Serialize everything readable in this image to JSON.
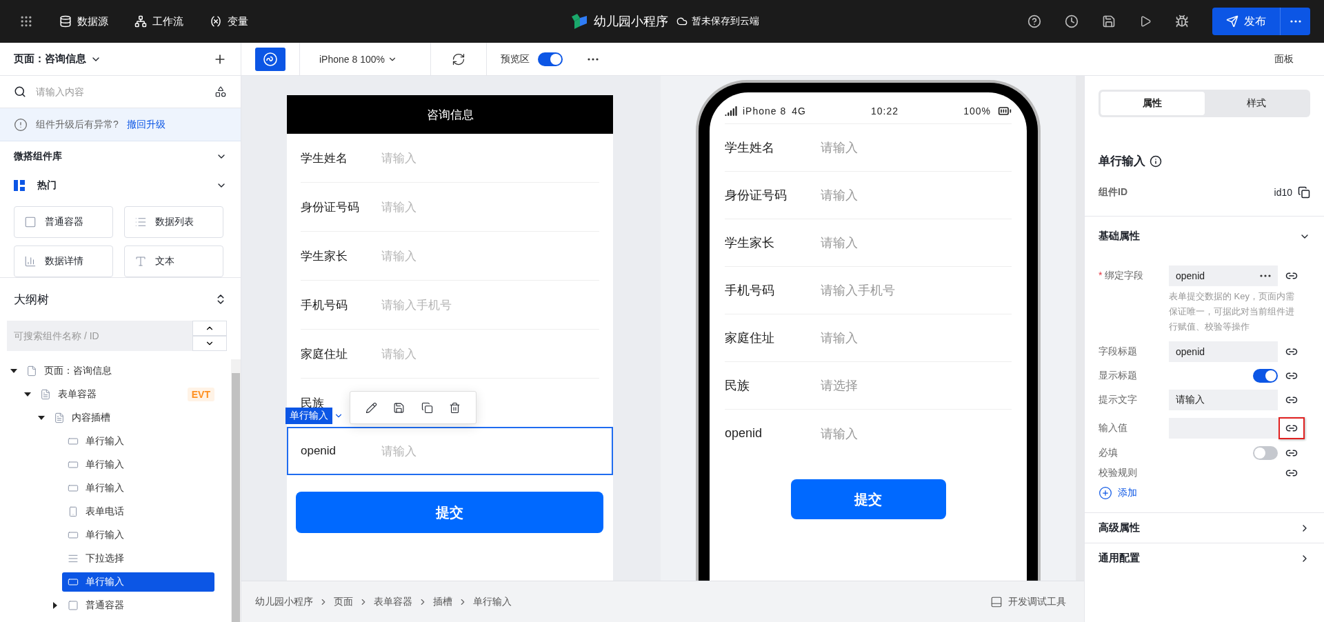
{
  "topbar": {
    "nav": [
      {
        "kind": "database",
        "label": "数据源"
      },
      {
        "kind": "workflow",
        "label": "工作流"
      },
      {
        "kind": "variable",
        "label": "变量"
      }
    ],
    "app_title": "幼儿园小程序",
    "save_status": "暂未保存到云端",
    "publish": "发布"
  },
  "toolbar": {
    "page_selector": "页面：咨询信息",
    "device": "iPhone 8 100%",
    "preview_label": "预览区",
    "preview_on": true,
    "panel_button": "面板"
  },
  "left_panel": {
    "search_placeholder": "请输入内容",
    "notice": {
      "text": "组件升级后有异常?",
      "link": "撤回升级"
    },
    "library_title": "微搭组件库",
    "category": "热门",
    "components": [
      {
        "kind": "container",
        "label": "普通容器"
      },
      {
        "kind": "list",
        "label": "数据列表"
      },
      {
        "kind": "detail",
        "label": "数据详情"
      },
      {
        "kind": "text",
        "label": "文本"
      }
    ],
    "outline_title": "大纲树",
    "outline_search_placeholder": "可搜索组件名称 / ID",
    "tree": [
      {
        "kind": "page",
        "label": "页面：咨询信息",
        "expanded": true,
        "selected": false,
        "children": [
          {
            "kind": "form",
            "label": "表单容器",
            "expanded": true,
            "selected": false,
            "badge": "EVT",
            "children": [
              {
                "kind": "form",
                "label": "内容插槽",
                "expanded": true,
                "selected": false,
                "children": [
                  {
                    "kind": "input",
                    "label": "单行输入",
                    "selected": false
                  },
                  {
                    "kind": "input",
                    "label": "单行输入",
                    "selected": false
                  },
                  {
                    "kind": "input",
                    "label": "单行输入",
                    "selected": false
                  },
                  {
                    "kind": "phone",
                    "label": "表单电话",
                    "selected": false
                  },
                  {
                    "kind": "input",
                    "label": "单行输入",
                    "selected": false
                  },
                  {
                    "kind": "select",
                    "label": "下拉选择",
                    "selected": false
                  },
                  {
                    "kind": "input",
                    "label": "单行输入",
                    "selected": true
                  },
                  {
                    "kind": "container",
                    "label": "普通容器",
                    "expanded": false,
                    "selected": false
                  }
                ]
              }
            ]
          }
        ]
      }
    ]
  },
  "canvas": {
    "form_title": "咨询信息",
    "rows": [
      {
        "label": "学生姓名",
        "placeholder": "请输入",
        "selected": false
      },
      {
        "label": "身份证号码",
        "placeholder": "请输入",
        "selected": false
      },
      {
        "label": "学生家长",
        "placeholder": "请输入",
        "selected": false
      },
      {
        "label": "手机号码",
        "placeholder": "请输入手机号",
        "selected": false
      },
      {
        "label": "家庭住址",
        "placeholder": "请输入",
        "selected": false
      },
      {
        "label": "民族",
        "selected": false
      },
      {
        "label": "openid",
        "placeholder": "请输入",
        "selected": true
      }
    ],
    "selection_tag": "单行输入",
    "submit": "提交"
  },
  "phone": {
    "carrier": "iPhone 8",
    "network": "4G",
    "time": "10:22",
    "battery": "100%",
    "rows": [
      {
        "label": "学生姓名",
        "placeholder": "请输入"
      },
      {
        "label": "身份证号码",
        "placeholder": "请输入"
      },
      {
        "label": "学生家长",
        "placeholder": "请输入"
      },
      {
        "label": "手机号码",
        "placeholder": "请输入手机号"
      },
      {
        "label": "家庭住址",
        "placeholder": "请输入"
      },
      {
        "label": "民族",
        "placeholder": "请选择"
      },
      {
        "label": "openid",
        "placeholder": "请输入"
      }
    ],
    "submit": "提交"
  },
  "breadcrumb": [
    "幼儿园小程序",
    "页面",
    "表单容器",
    "插槽",
    "单行输入"
  ],
  "debug_tools": "开发调试工具",
  "properties": {
    "tabs": [
      {
        "label": "属性",
        "selected": true
      },
      {
        "label": "样式",
        "selected": false
      }
    ],
    "title": "单行输入",
    "id_label": "组件ID",
    "id_value": "id10",
    "basic": {
      "title": "基础属性",
      "expanded": true,
      "required_mark": "*",
      "fields": [
        {
          "kind": "binding",
          "label": "绑定字段",
          "required": true,
          "highlighted": false,
          "value": "openid",
          "help": "表单提交数据的 Key，页面内需保证唯一，可据此对当前组件进行赋值、校验等操作"
        },
        {
          "kind": "text",
          "label": "字段标题",
          "required": false,
          "highlighted": false,
          "value": "openid"
        },
        {
          "kind": "switch",
          "label": "显示标题",
          "required": false,
          "highlighted": false,
          "on": true
        },
        {
          "kind": "text",
          "label": "提示文字",
          "required": false,
          "highlighted": false,
          "value": "请输入"
        },
        {
          "kind": "text",
          "label": "输入值",
          "required": false,
          "highlighted": true
        },
        {
          "kind": "switch",
          "label": "必填",
          "required": false,
          "highlighted": false,
          "on": false
        },
        {
          "kind": "rules",
          "label": "校验规则",
          "required": false,
          "highlighted": false
        }
      ],
      "add": "添加"
    },
    "sections": [
      {
        "title": "高级属性",
        "expanded": false
      },
      {
        "title": "通用配置",
        "expanded": false
      }
    ]
  }
}
